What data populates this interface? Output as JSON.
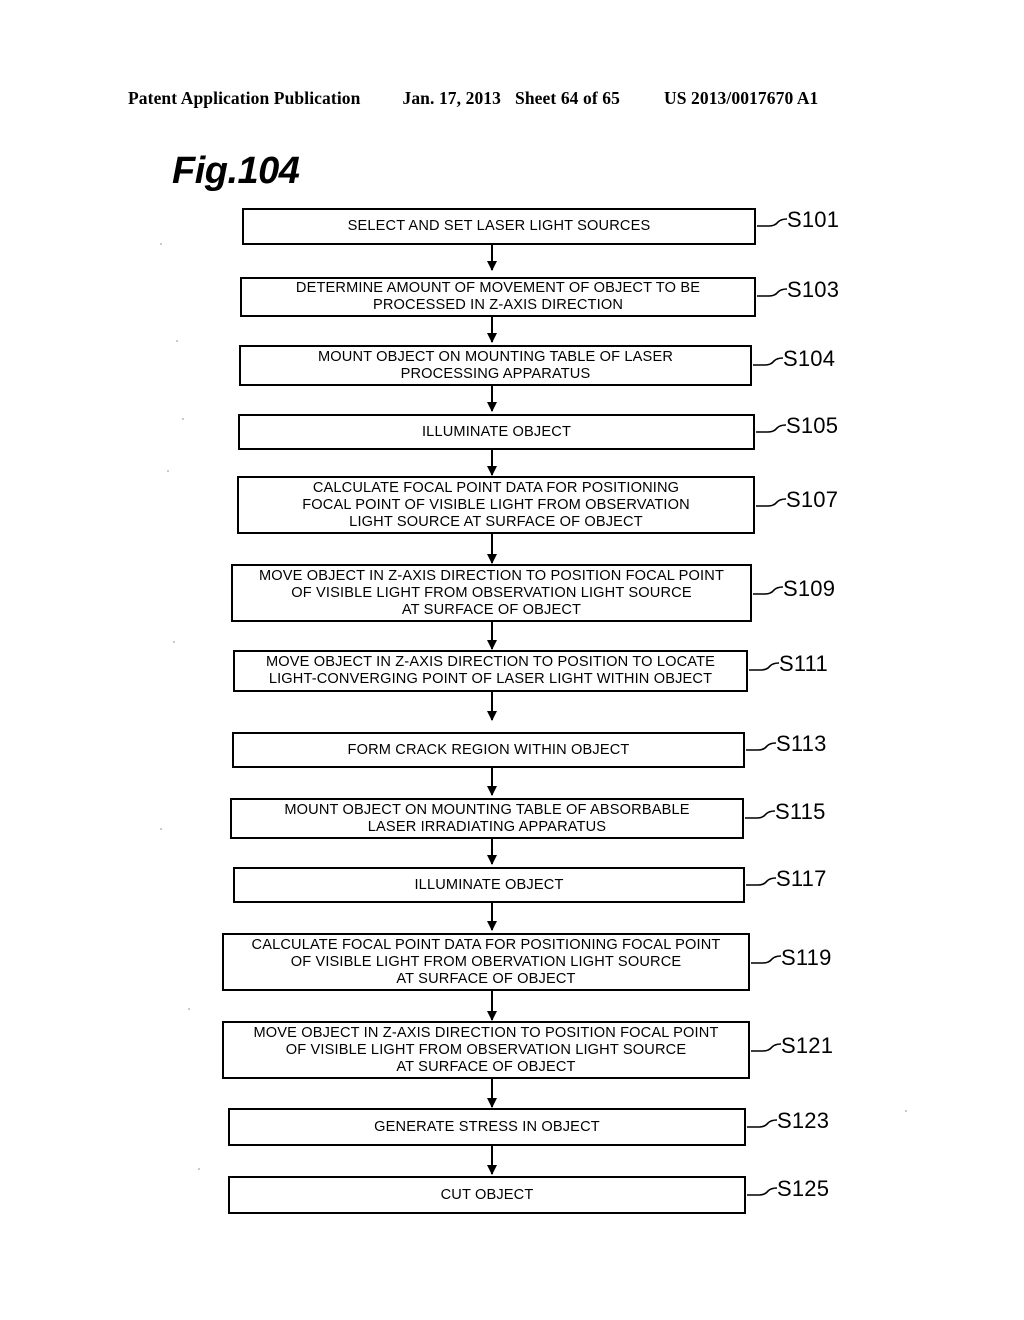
{
  "header": {
    "publication": "Patent Application Publication",
    "date": "Jan. 17, 2013",
    "sheet": "Sheet 64 of 65",
    "number": "US 2013/0017670 A1"
  },
  "figure": {
    "title": "Fig.104"
  },
  "chart_data": {
    "type": "flowchart",
    "title": "Fig.104",
    "orientation": "vertical",
    "connector": "arrow-down",
    "nodes": [
      {
        "id": "S101",
        "ref": "S101",
        "text": "SELECT AND SET LASER LIGHT SOURCES",
        "lines": 1
      },
      {
        "id": "S103",
        "ref": "S103",
        "text": "DETERMINE AMOUNT OF MOVEMENT OF OBJECT TO BE\nPROCESSED IN Z-AXIS DIRECTION",
        "lines": 2
      },
      {
        "id": "S104",
        "ref": "S104",
        "text": "MOUNT OBJECT ON MOUNTING TABLE OF LASER\nPROCESSING APPARATUS",
        "lines": 2
      },
      {
        "id": "S105",
        "ref": "S105",
        "text": "ILLUMINATE OBJECT",
        "lines": 1
      },
      {
        "id": "S107",
        "ref": "S107",
        "text": "CALCULATE FOCAL POINT DATA FOR POSITIONING\nFOCAL POINT OF VISIBLE LIGHT FROM OBSERVATION\nLIGHT SOURCE AT SURFACE OF OBJECT",
        "lines": 3
      },
      {
        "id": "S109",
        "ref": "S109",
        "text": "MOVE OBJECT IN Z-AXIS DIRECTION TO POSITION FOCAL POINT\nOF VISIBLE LIGHT FROM OBSERVATION LIGHT SOURCE\nAT SURFACE OF OBJECT",
        "lines": 3
      },
      {
        "id": "S111",
        "ref": "S111",
        "text": "MOVE OBJECT IN Z-AXIS DIRECTION TO POSITION TO LOCATE\nLIGHT-CONVERGING POINT OF LASER LIGHT WITHIN OBJECT",
        "lines": 2
      },
      {
        "id": "S113",
        "ref": "S113",
        "text": "FORM CRACK REGION WITHIN OBJECT",
        "lines": 1
      },
      {
        "id": "S115",
        "ref": "S115",
        "text": "MOUNT OBJECT ON MOUNTING TABLE OF ABSORBABLE\nLASER IRRADIATING APPARATUS",
        "lines": 2
      },
      {
        "id": "S117",
        "ref": "S117",
        "text": "ILLUMINATE OBJECT",
        "lines": 1
      },
      {
        "id": "S119",
        "ref": "S119",
        "text": "CALCULATE FOCAL POINT DATA FOR POSITIONING FOCAL POINT\nOF VISIBLE LIGHT FROM OBERVATION LIGHT SOURCE\nAT SURFACE OF OBJECT",
        "lines": 3
      },
      {
        "id": "S121",
        "ref": "S121",
        "text": "MOVE OBJECT IN Z-AXIS DIRECTION TO POSITION FOCAL POINT\nOF VISIBLE LIGHT FROM OBSERVATION LIGHT SOURCE\nAT SURFACE OF OBJECT",
        "lines": 3
      },
      {
        "id": "S123",
        "ref": "S123",
        "text": "GENERATE STRESS IN OBJECT",
        "lines": 1
      },
      {
        "id": "S125",
        "ref": "S125",
        "text": "CUT OBJECT",
        "lines": 1
      }
    ],
    "edges": [
      {
        "from": "S101",
        "to": "S103"
      },
      {
        "from": "S103",
        "to": "S104"
      },
      {
        "from": "S104",
        "to": "S105"
      },
      {
        "from": "S105",
        "to": "S107"
      },
      {
        "from": "S107",
        "to": "S109"
      },
      {
        "from": "S109",
        "to": "S111"
      },
      {
        "from": "S111",
        "to": "S113"
      },
      {
        "from": "S113",
        "to": "S115"
      },
      {
        "from": "S115",
        "to": "S117"
      },
      {
        "from": "S117",
        "to": "S119"
      },
      {
        "from": "S119",
        "to": "S121"
      },
      {
        "from": "S121",
        "to": "S123"
      },
      {
        "from": "S123",
        "to": "S125"
      }
    ]
  }
}
